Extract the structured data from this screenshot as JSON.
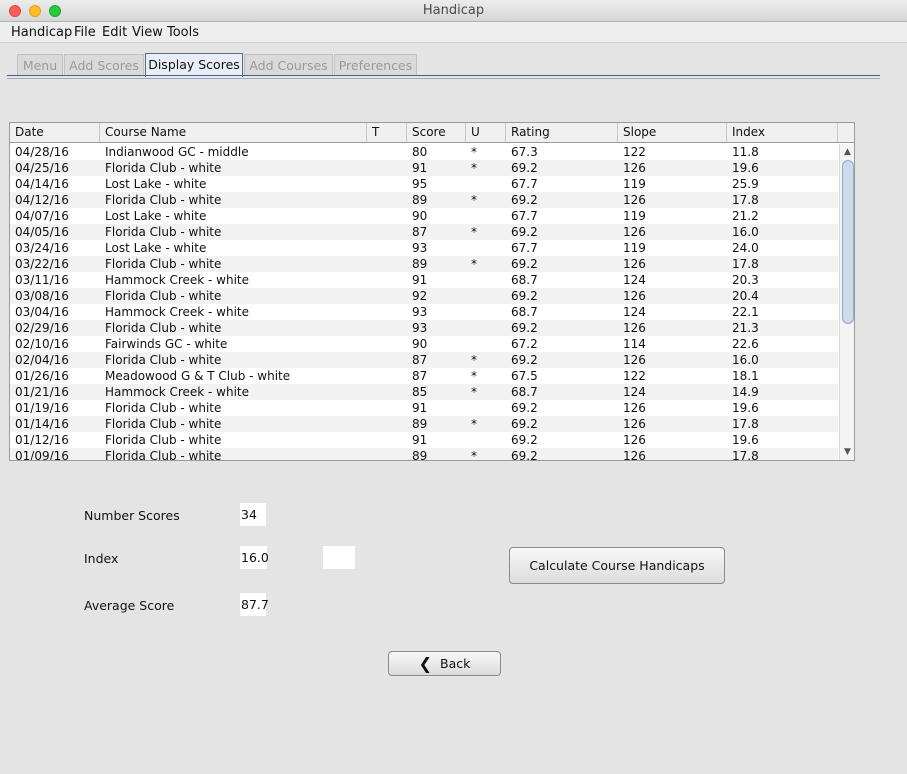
{
  "window": {
    "title": "Handicap"
  },
  "menu": {
    "items": [
      "Handicap",
      "File",
      "Edit",
      "View",
      "Tools"
    ]
  },
  "tabs": [
    "Menu",
    "Add Scores",
    "Display Scores",
    "Add Courses",
    "Preferences"
  ],
  "active_tab": "Display Scores",
  "table": {
    "columns": [
      "Date",
      "Course Name",
      "T",
      "Score",
      "U",
      "Rating",
      "Slope",
      "Index"
    ],
    "rows": [
      [
        "04/28/16",
        "Indianwood GC - middle",
        "",
        "80",
        "*",
        "67.3",
        "122",
        "11.8"
      ],
      [
        "04/25/16",
        "Florida Club - white",
        "",
        "91",
        "*",
        "69.2",
        "126",
        "19.6"
      ],
      [
        "04/14/16",
        "Lost Lake - white",
        "",
        "95",
        "",
        "67.7",
        "119",
        "25.9"
      ],
      [
        "04/12/16",
        "Florida Club - white",
        "",
        "89",
        "*",
        "69.2",
        "126",
        "17.8"
      ],
      [
        "04/07/16",
        "Lost Lake - white",
        "",
        "90",
        "",
        "67.7",
        "119",
        "21.2"
      ],
      [
        "04/05/16",
        "Florida Club - white",
        "",
        "87",
        "*",
        "69.2",
        "126",
        "16.0"
      ],
      [
        "03/24/16",
        "Lost Lake - white",
        "",
        "93",
        "",
        "67.7",
        "119",
        "24.0"
      ],
      [
        "03/22/16",
        "Florida Club - white",
        "",
        "89",
        "*",
        "69.2",
        "126",
        "17.8"
      ],
      [
        "03/11/16",
        "Hammock Creek - white",
        "",
        "91",
        "",
        "68.7",
        "124",
        "20.3"
      ],
      [
        "03/08/16",
        "Florida Club - white",
        "",
        "92",
        "",
        "69.2",
        "126",
        "20.4"
      ],
      [
        "03/04/16",
        "Hammock Creek - white",
        "",
        "93",
        "",
        "68.7",
        "124",
        "22.1"
      ],
      [
        "02/29/16",
        "Florida Club - white",
        "",
        "93",
        "",
        "69.2",
        "126",
        "21.3"
      ],
      [
        "02/10/16",
        "Fairwinds GC - white",
        "",
        "90",
        "",
        "67.2",
        "114",
        "22.6"
      ],
      [
        "02/04/16",
        "Florida Club - white",
        "",
        "87",
        "*",
        "69.2",
        "126",
        "16.0"
      ],
      [
        "01/26/16",
        "Meadowood G & T Club - white",
        "",
        "87",
        "*",
        "67.5",
        "122",
        "18.1"
      ],
      [
        "01/21/16",
        "Hammock Creek - white",
        "",
        "85",
        "*",
        "68.7",
        "124",
        "14.9"
      ],
      [
        "01/19/16",
        "Florida Club - white",
        "",
        "91",
        "",
        "69.2",
        "126",
        "19.6"
      ],
      [
        "01/14/16",
        "Florida Club - white",
        "",
        "89",
        "*",
        "69.2",
        "126",
        "17.8"
      ],
      [
        "01/12/16",
        "Florida Club - white",
        "",
        "91",
        "",
        "69.2",
        "126",
        "19.6"
      ],
      [
        "01/09/16",
        "Florida Club - white",
        "",
        "89",
        "*",
        "69.2",
        "126",
        "17.8"
      ]
    ]
  },
  "stats": {
    "number_scores_label": "Number Scores",
    "number_scores_value": "34",
    "index_label": "Index",
    "index_value": "16.0",
    "index_extra_value": "",
    "average_label": "Average Score",
    "average_value": "87.7"
  },
  "buttons": {
    "calculate": "Calculate Course Handicaps",
    "back": "Back",
    "back_icon": "chevron-left-icon"
  }
}
